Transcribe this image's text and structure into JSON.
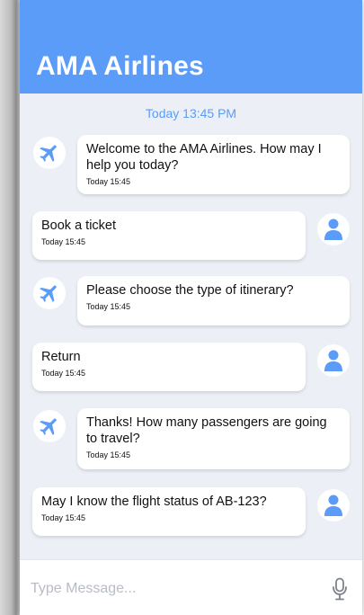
{
  "header": {
    "title": "AMA Airlines"
  },
  "chat": {
    "date_separator": "Today 13:45 PM",
    "messages": [
      {
        "sender": "bot",
        "text": "Welcome to the AMA Airlines. How may I help you today?",
        "time": "Today 15:45"
      },
      {
        "sender": "user",
        "text": "Book a ticket",
        "time": "Today 15:45"
      },
      {
        "sender": "bot",
        "text": "Please choose the type of itinerary?",
        "time": "Today 15:45"
      },
      {
        "sender": "user",
        "text": "Return",
        "time": "Today 15:45"
      },
      {
        "sender": "bot",
        "text": "Thanks! How many passengers are going to travel?",
        "time": "Today 15:45"
      },
      {
        "sender": "user",
        "text": "May I know the flight status of AB-123?",
        "time": "Today 15:45"
      }
    ]
  },
  "composer": {
    "placeholder": "Type Message...",
    "mic_icon": "microphone-icon"
  },
  "icons": {
    "bot": "airplane-icon",
    "user": "user-icon"
  },
  "colors": {
    "brand": "#5b9cf8",
    "background": "#eceff5",
    "bubble": "#ffffff"
  }
}
